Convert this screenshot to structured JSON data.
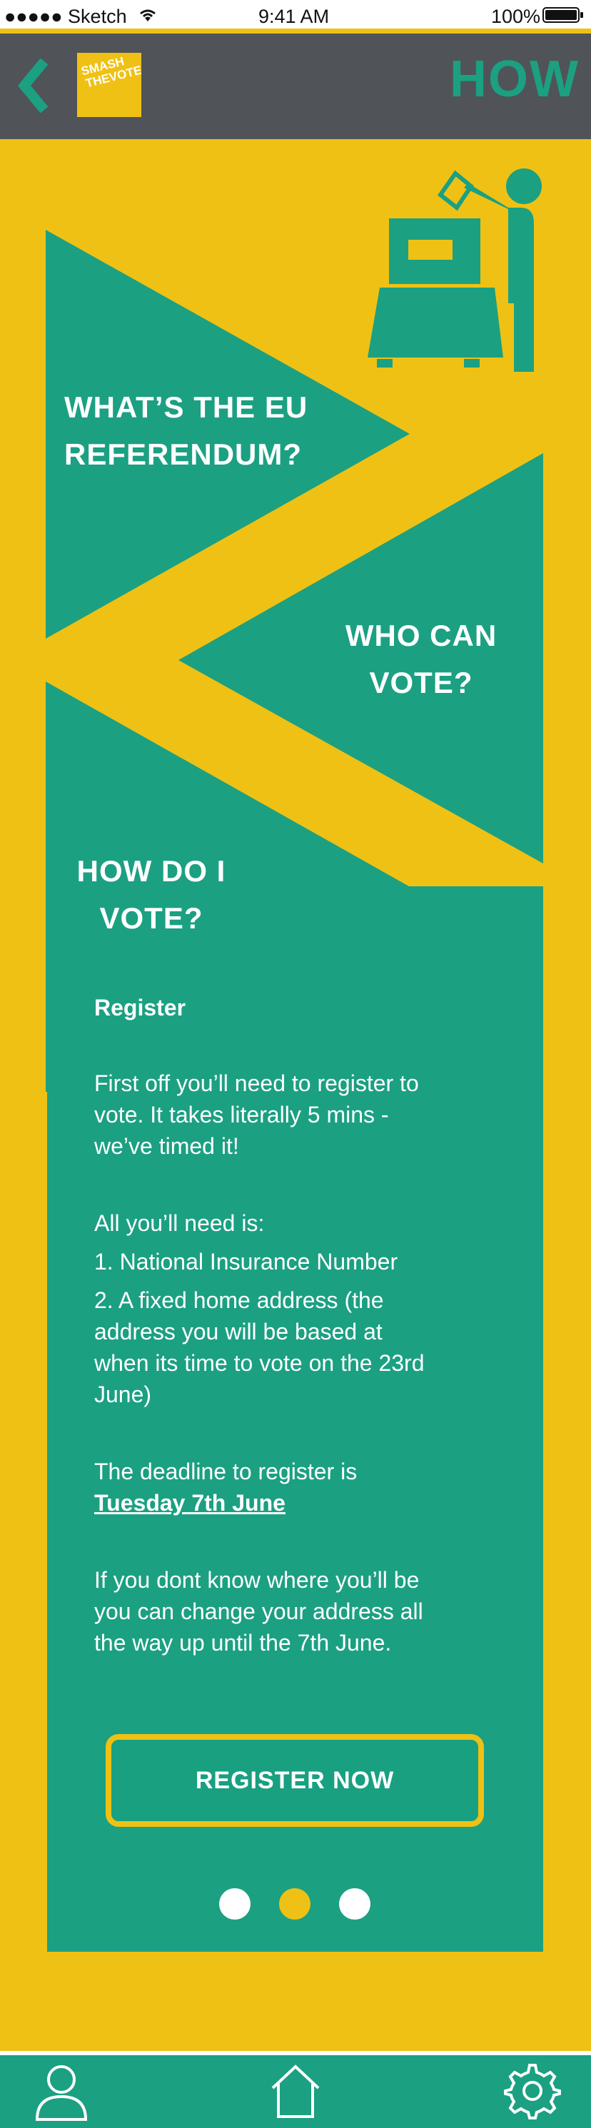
{
  "status_bar": {
    "carrier": "●●●●● Sketch",
    "time": "9:41 AM",
    "battery": "100%"
  },
  "header": {
    "logo_line1": "SMASH",
    "logo_line2": "THEVOTE!",
    "title": "HOW"
  },
  "sections": {
    "eu_referendum_line1": "WHAT’S THE EU",
    "eu_referendum_line2": "REFERENDUM?",
    "who_can_vote_line1": "WHO CAN",
    "who_can_vote_line2": "VOTE?",
    "how_do_i_vote_line1": "HOW DO I",
    "how_do_i_vote_line2": "VOTE?"
  },
  "content": {
    "heading": "Register",
    "p1_lines": [
      "First off you’ll need to register to",
      "vote. It takes literally 5 mins -",
      "we’ve timed it!"
    ],
    "p2_intro": "All you’ll need is:",
    "p2_item1": "1. National Insurance Number",
    "p2_item2_lines": [
      "2. A fixed home address (the",
      "address you will be based at",
      "when its time to vote on the 23rd",
      "June)"
    ],
    "p3_line1": "The deadline to register is",
    "p3_deadline": "Tuesday 7th June",
    "p4_lines": [
      "If you dont know where you’ll be",
      "you can change your address all",
      "the way up until the 7th June."
    ],
    "button_label": "REGISTER NOW"
  },
  "pagination": {
    "total": 3,
    "active_index": 1
  },
  "nav": {
    "icons": [
      "profile-icon",
      "home-icon",
      "settings-icon"
    ]
  },
  "colors": {
    "brand_yellow": "#efc114",
    "brand_green": "#1ba082",
    "header_gray": "#505358"
  }
}
